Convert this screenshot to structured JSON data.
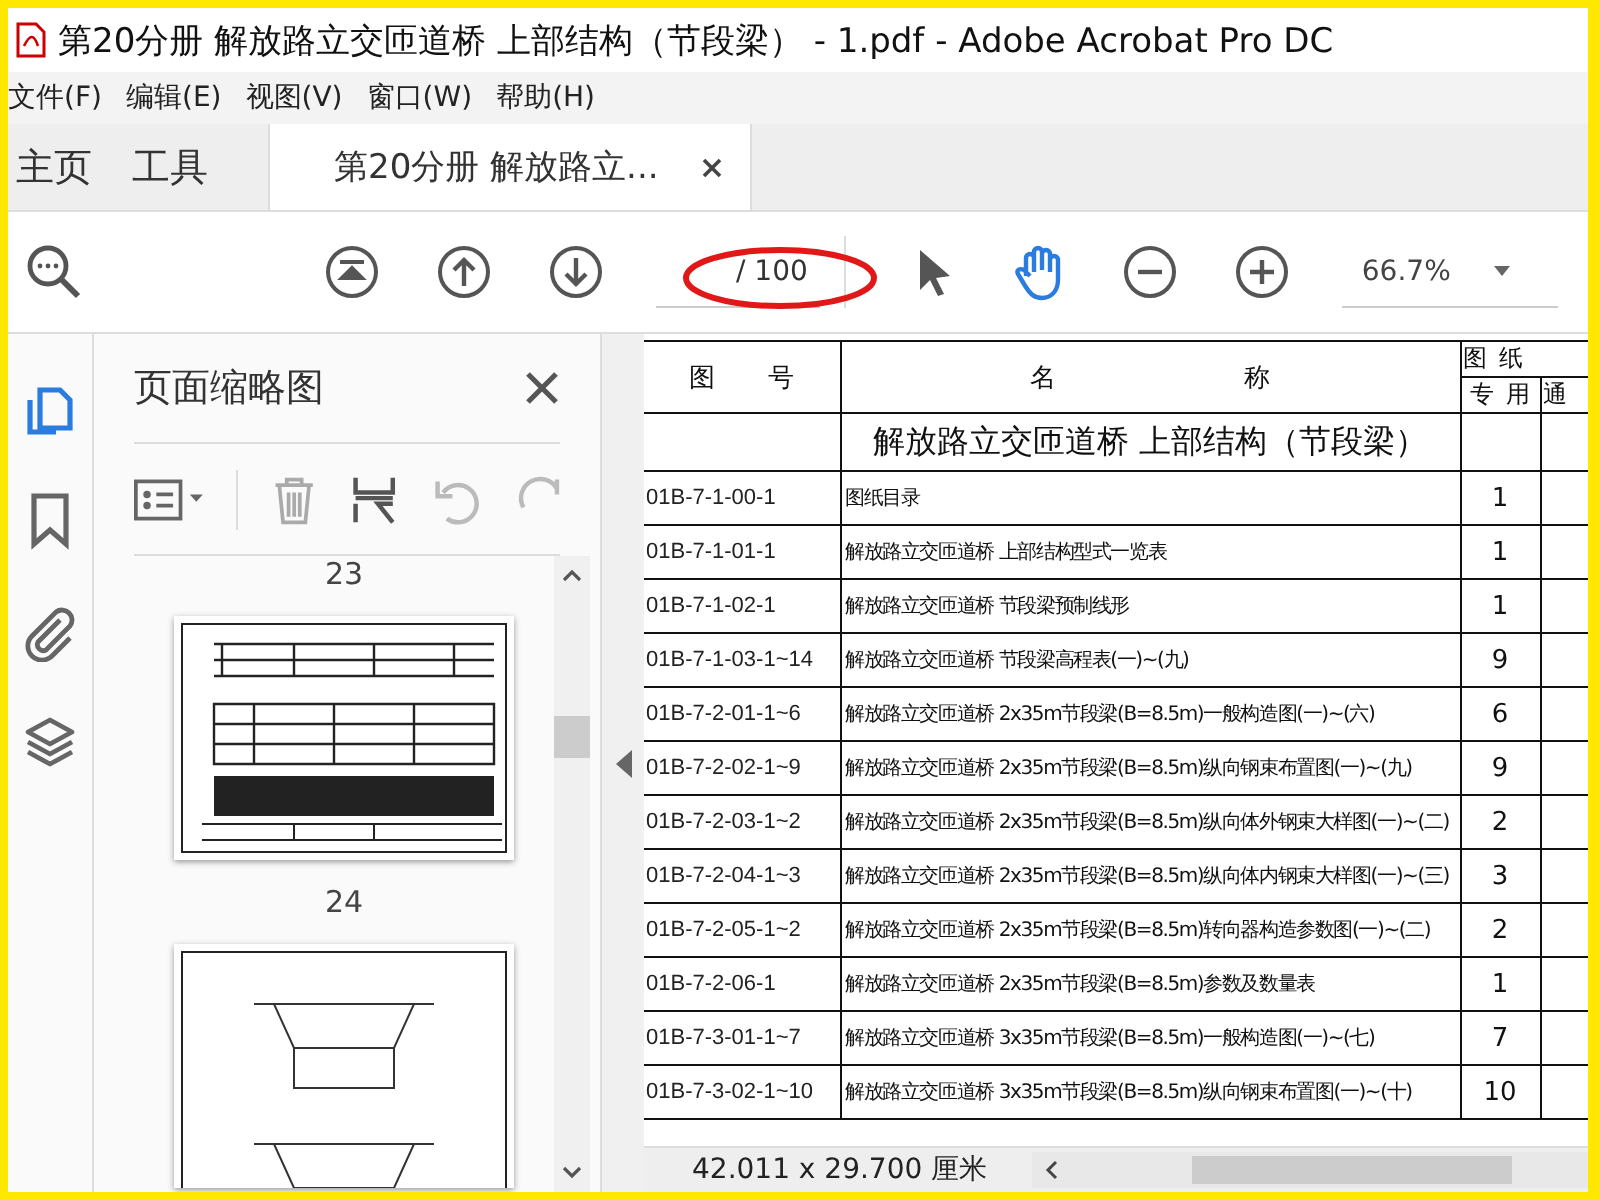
{
  "window": {
    "title": "第20分册 解放路立交匝道桥 上部结构（节段梁） - 1.pdf - Adobe Acrobat Pro DC"
  },
  "menu": [
    "文件(F)",
    "编辑(E)",
    "视图(V)",
    "窗口(W)",
    "帮助(H)"
  ],
  "tabs": [
    {
      "label": "主页",
      "kind": "nav",
      "selected": false
    },
    {
      "label": "工具",
      "kind": "nav",
      "selected": false
    },
    {
      "label": "第20分册 解放路立...",
      "kind": "document",
      "selected": true
    }
  ],
  "toolbar": {
    "page_total": "/ 100",
    "zoom": "66.7%",
    "tools": [
      {
        "kind": "select",
        "selected": false
      },
      {
        "kind": "hand",
        "selected": true
      }
    ]
  },
  "sidebar": {
    "items": [
      {
        "kind": "pages",
        "selected": true
      },
      {
        "kind": "bookmarks",
        "selected": false
      },
      {
        "kind": "attachments",
        "selected": false
      },
      {
        "kind": "layers",
        "selected": false
      }
    ]
  },
  "thumbnails": {
    "title": "页面缩略图",
    "items": [
      {
        "kind": "label",
        "text": "23"
      },
      {
        "kind": "plan"
      },
      {
        "kind": "label",
        "text": "24"
      },
      {
        "kind": "section"
      }
    ]
  },
  "document": {
    "header": {
      "number": "图 号",
      "name": "名 称",
      "sheets": "图 纸",
      "dedicated": "专 用",
      "common": "通"
    },
    "heading": "解放路立交匝道桥 上部结构（节段梁）",
    "rows": [
      {
        "number": "01B-7-1-00-1",
        "name": "图纸目录",
        "count": "1"
      },
      {
        "number": "01B-7-1-01-1",
        "name": "解放路立交匝道桥 上部结构型式一览表",
        "count": "1"
      },
      {
        "number": "01B-7-1-02-1",
        "name": "解放路立交匝道桥 节段梁预制线形",
        "count": "1"
      },
      {
        "number": "01B-7-1-03-1~14",
        "name": "解放路立交匝道桥 节段梁高程表(一)~(九)",
        "count": "9"
      },
      {
        "number": "01B-7-2-01-1~6",
        "name": "解放路立交匝道桥 2x35m节段梁(B=8.5m)一般构造图(一)~(六)",
        "count": "6"
      },
      {
        "number": "01B-7-2-02-1~9",
        "name": "解放路立交匝道桥 2x35m节段梁(B=8.5m)纵向钢束布置图(一)~(九)",
        "count": "9"
      },
      {
        "number": "01B-7-2-03-1~2",
        "name": "解放路立交匝道桥 2x35m节段梁(B=8.5m)纵向体外钢束大样图(一)~(二)",
        "count": "2"
      },
      {
        "number": "01B-7-2-04-1~3",
        "name": "解放路立交匝道桥 2x35m节段梁(B=8.5m)纵向体内钢束大样图(一)~(三)",
        "count": "3"
      },
      {
        "number": "01B-7-2-05-1~2",
        "name": "解放路立交匝道桥 2x35m节段梁(B=8.5m)转向器构造参数图(一)~(二)",
        "count": "2"
      },
      {
        "number": "01B-7-2-06-1",
        "name": "解放路立交匝道桥 2x35m节段梁(B=8.5m)参数及数量表",
        "count": "1"
      },
      {
        "number": "01B-7-3-01-1~7",
        "name": "解放路立交匝道桥 3x35m节段梁(B=8.5m)一般构造图(一)~(七)",
        "count": "7"
      },
      {
        "number": "01B-7-3-02-1~10",
        "name": "解放路立交匝道桥 3x35m节段梁(B=8.5m)纵向钢束布置图(一)~(十)",
        "count": "10"
      }
    ]
  },
  "status_bar": {
    "size": "42.011 x 29.700 厘米"
  }
}
